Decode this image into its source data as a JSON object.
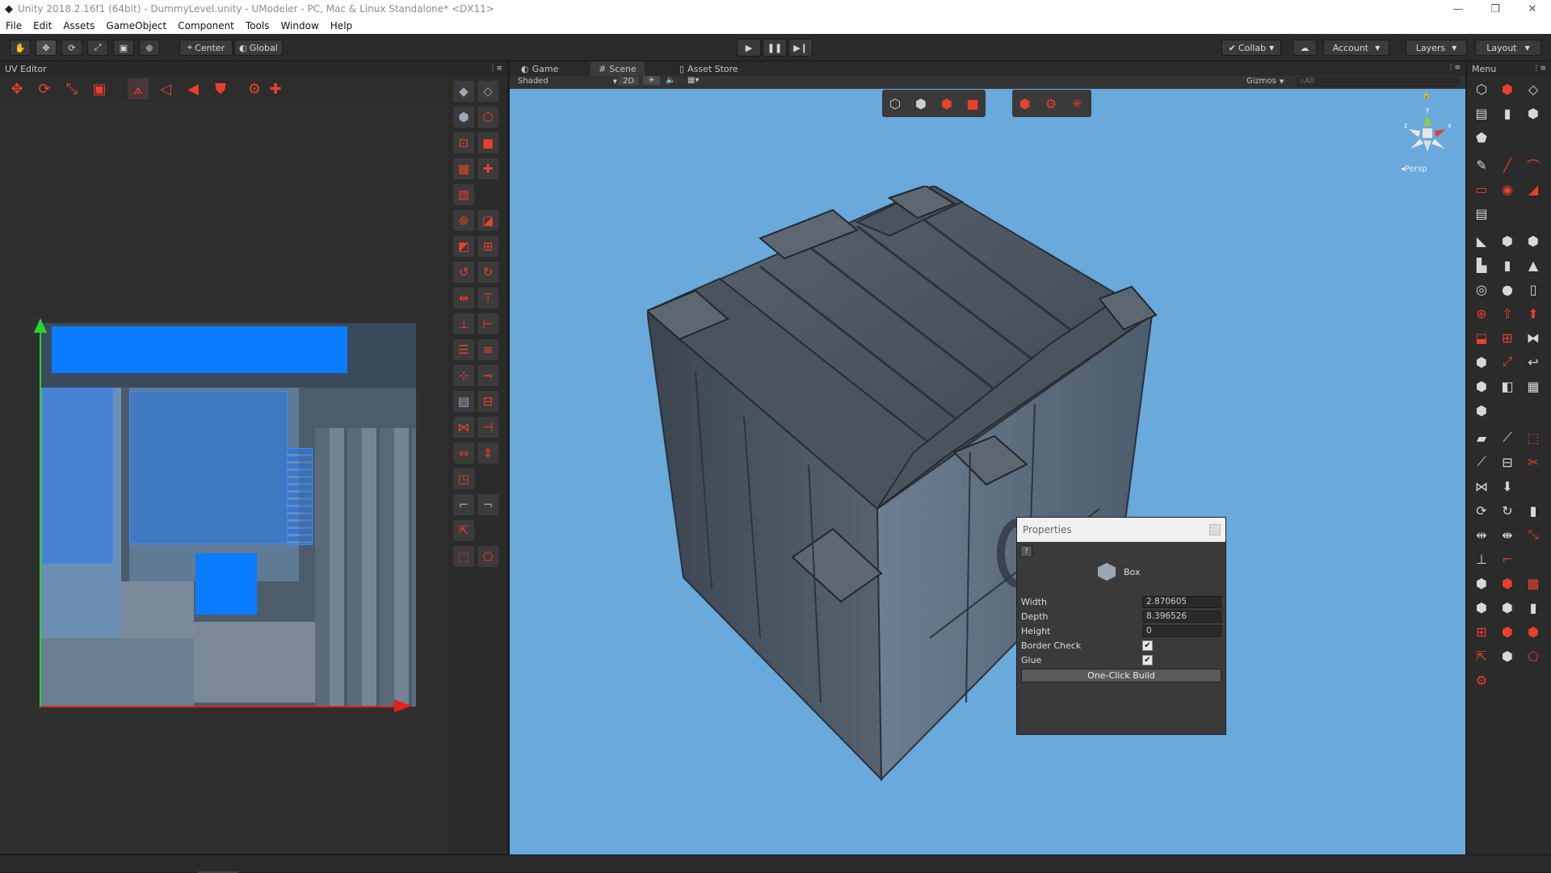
{
  "window": {
    "title": "Unity 2018.2.16f1 (64bit) - DummyLevel.unity - UModeler - PC, Mac & Linux Standalone* <DX11>",
    "minimize": "—",
    "maximize": "❐",
    "close": "✕"
  },
  "menu": [
    "File",
    "Edit",
    "Assets",
    "GameObject",
    "Component",
    "Tools",
    "Window",
    "Help"
  ],
  "toolbar": {
    "pivot_label": "Center",
    "space_label": "Global",
    "collab_label": "Collab",
    "account_label": "Account",
    "layers_label": "Layers",
    "layout_label": "Layout"
  },
  "uv_editor": {
    "title": "UV Editor"
  },
  "scene": {
    "tabs": {
      "game": "Game",
      "scene": "Scene",
      "asset_store": "Asset Store"
    },
    "shading_mode": "Shaded",
    "mode_2d": "2D",
    "gizmos_label": "Gizmos",
    "search_placeholder": "All",
    "persp_label": "Persp"
  },
  "menu_panel": {
    "title": "Menu"
  },
  "properties": {
    "title": "Properties",
    "help": "?",
    "object_name": "Box",
    "fields": {
      "width_label": "Width",
      "width_value": "2.870605",
      "depth_label": "Depth",
      "depth_value": "8.396526",
      "height_label": "Height",
      "height_value": "0",
      "border_check_label": "Border Check",
      "border_check_value": true,
      "glue_label": "Glue",
      "glue_value": true
    },
    "build_button": "One-Click Build"
  },
  "colors": {
    "viewport_bg": "#69a9db",
    "accent_red": "#e8412c",
    "uv_select": "#0a7cff"
  }
}
